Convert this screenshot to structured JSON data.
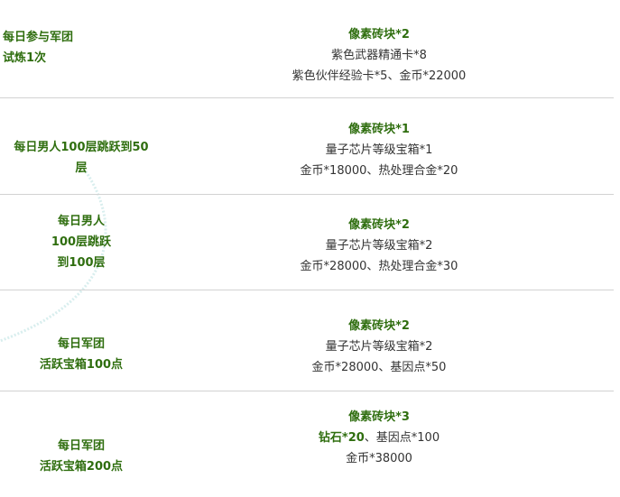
{
  "rows": [
    {
      "task": [
        "每日参与军团",
        "试炼1次"
      ],
      "rewards": [
        "像素砖块*2",
        "紫色武器精通卡*8",
        "紫色伙伴经验卡*5、金币*22000"
      ]
    },
    {
      "task": [
        "每日男人100层跳跃到50",
        "层"
      ],
      "rewards": [
        "像素砖块*1",
        "量子芯片等级宝箱*1",
        "金币*18000、热处理合金*20"
      ]
    },
    {
      "task": [
        "每日男人",
        "100层跳跃",
        "到100层"
      ],
      "rewards": [
        "像素砖块*2",
        "量子芯片等级宝箱*2",
        "金币*28000、热处理合金*30"
      ]
    },
    {
      "task": [
        "每日军团",
        "活跃宝箱100点"
      ],
      "rewards": [
        "像素砖块*2",
        "量子芯片等级宝箱*2",
        "金币*28000、基因点*50"
      ]
    },
    {
      "task": [
        "每日军团",
        "活跃宝箱200点"
      ],
      "rewards": [
        "像素砖块*3",
        "钻石*20",
        "、基因点*100",
        "金币*38000"
      ]
    }
  ]
}
